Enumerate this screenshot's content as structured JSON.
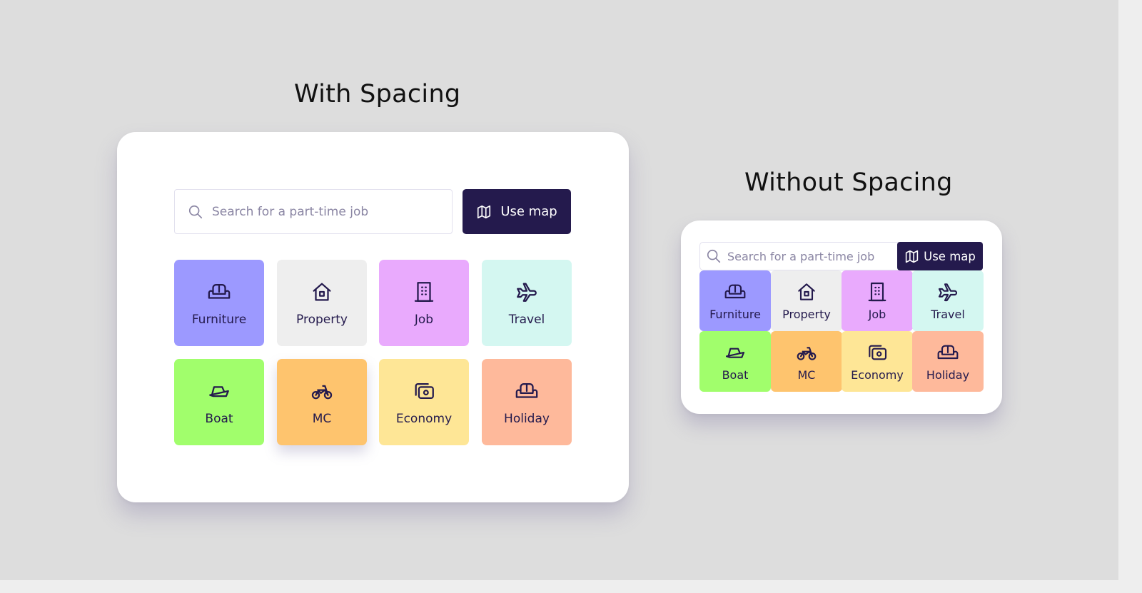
{
  "headings": {
    "with_spacing": "With Spacing",
    "without_spacing": "Without Spacing"
  },
  "search": {
    "placeholder": "Search for a part-time job",
    "icon": "search-icon"
  },
  "map_button": {
    "label": "Use map",
    "icon": "map-icon"
  },
  "categories": [
    {
      "label": "Furniture",
      "icon": "sofa-icon",
      "color": "#9c99ff"
    },
    {
      "label": "Property",
      "icon": "house-icon",
      "color": "#eeeeee"
    },
    {
      "label": "Job",
      "icon": "building-icon",
      "color": "#e9aafd"
    },
    {
      "label": "Travel",
      "icon": "airplane-icon",
      "color": "#d4f7f1"
    },
    {
      "label": "Boat",
      "icon": "boat-icon",
      "color": "#a1fe6c"
    },
    {
      "label": "MC",
      "icon": "motorcycle-icon",
      "color": "#fec46e"
    },
    {
      "label": "Economy",
      "icon": "money-icon",
      "color": "#fee696"
    },
    {
      "label": "Holiday",
      "icon": "sofa-icon",
      "color": "#feb99b"
    }
  ],
  "colors": {
    "background": "#dddddd",
    "primary": "#241a4d",
    "card": "#ffffff",
    "placeholder_text": "#8a85a3"
  }
}
